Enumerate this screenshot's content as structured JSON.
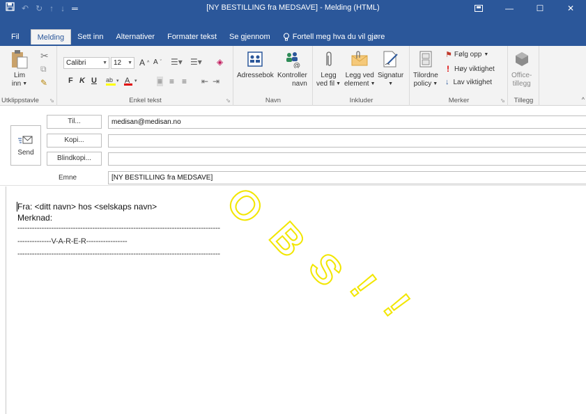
{
  "window": {
    "title": "[NY BESTILLING fra MEDSAVE] - Melding (HTML)",
    "qat_icons": [
      "save-icon",
      "undo-icon",
      "redo-icon",
      "arrow-up-icon",
      "arrow-down-icon",
      "customize-icon"
    ],
    "controls": [
      "ribbon-display-icon",
      "minimize-icon",
      "maximize-icon",
      "close-icon"
    ]
  },
  "tabs": [
    "Fil",
    "Melding",
    "Sett inn",
    "Alternativer",
    "Formater tekst",
    "Se gjennom"
  ],
  "tell_me": "Fortell meg hva du vil gjøre",
  "ribbon": {
    "clipboard": {
      "paste": "Lim",
      "paste2": "inn",
      "label": "Utklippstavle"
    },
    "font": {
      "family": "Calibri",
      "size": "12",
      "bold": "F",
      "italic": "K",
      "underline": "U",
      "label": "Enkel tekst"
    },
    "names": {
      "addressbook": "Adressebok",
      "check": "Kontroller",
      "check2": "navn",
      "label": "Navn"
    },
    "include": {
      "attach": "Legg",
      "attach2": "ved fil",
      "item": "Legg ved",
      "item2": "element",
      "signature": "Signatur",
      "label": "Inkluder"
    },
    "tags": {
      "assign": "Tilordne",
      "assign2": "policy",
      "follow": "Følg opp",
      "high": "Høy viktighet",
      "low": "Lav viktighet",
      "label": "Merker"
    },
    "addins": {
      "office": "Office-",
      "office2": "tillegg",
      "label": "Tillegg"
    }
  },
  "form": {
    "send": "Send",
    "to_btn": "Til...",
    "cc_btn": "Kopi...",
    "bcc_btn": "Blindkopi...",
    "subject_label": "Emne",
    "to_value": "medisan@medisan.no",
    "cc_value": "",
    "bcc_value": "",
    "subject_value": "[NY BESTILLING fra MEDSAVE]"
  },
  "body": {
    "line1": "Fra: <ditt navn> hos <selskaps navn>",
    "line2": "Merknad:",
    "sep1": "------------------------------------------------------------------------------------",
    "varer": "--------------V-A-R-E-R-----------------",
    "sep2": "------------------------------------------------------------------------------------"
  },
  "watermark": {
    "text": "OBS!!",
    "color": "#f2e600"
  },
  "colors": {
    "accent": "#2b579a"
  }
}
